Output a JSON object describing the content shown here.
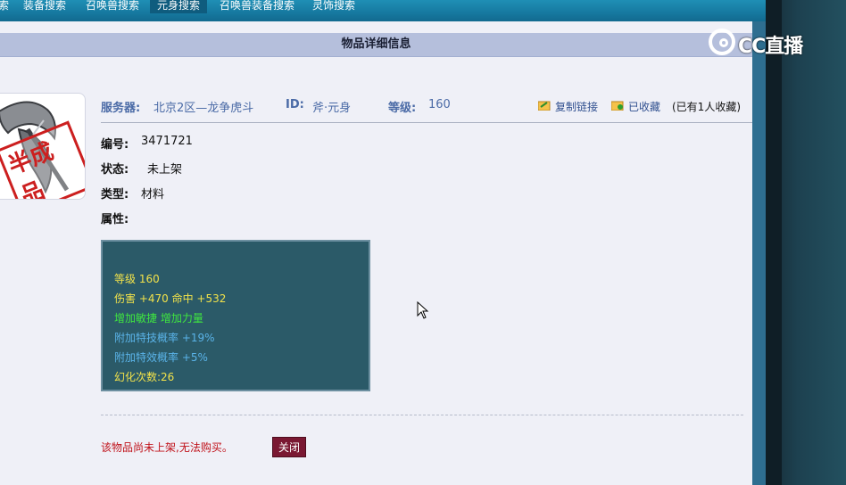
{
  "nav": {
    "tabs": [
      {
        "label": "索"
      },
      {
        "label": "装备搜索"
      },
      {
        "label": "召唤兽搜索"
      },
      {
        "label": "元身搜索",
        "active": true
      },
      {
        "label": "召唤兽装备搜索"
      },
      {
        "label": "灵饰搜索"
      }
    ]
  },
  "watermark": {
    "text": "CC直播"
  },
  "panel": {
    "title": "物品详细信息"
  },
  "item_image": {
    "stamp_text": "半成品"
  },
  "info": {
    "server_label": "服务器:",
    "server_value": "北京2区—龙争虎斗",
    "id_label": "ID:",
    "id_value": "斧·元身",
    "level_label": "等级:",
    "level_value": "160",
    "copy_link": "复制链接",
    "favorited": "已收藏",
    "favorite_count": "(已有1人收藏)"
  },
  "fields": {
    "number_label": "编号:",
    "number_value": "3471721",
    "status_label": "状态:",
    "status_value": "未上架",
    "type_label": "类型:",
    "type_value": "材料",
    "attr_label": "属性:"
  },
  "attributes": [
    {
      "text": "等级 160",
      "color": "#f2e24a"
    },
    {
      "text": "伤害 +470 命中 +532",
      "color": "#f2e24a"
    },
    {
      "text": "增加敏捷 增加力量",
      "color": "#3fe63f"
    },
    {
      "text": "附加特技概率 +19%",
      "color": "#5ab3e8"
    },
    {
      "text": "附加特效概率 +5%",
      "color": "#5ab3e8"
    },
    {
      "text": "幻化次数:26",
      "color": "#f2e24a"
    }
  ],
  "bottom": {
    "notice": "该物品尚未上架,无法购买。",
    "close_label": "关闭"
  },
  "colors": {
    "nav_bg": "#1679a0",
    "header_bg": "#b5bfdc",
    "attr_box_bg": "#2b5a68",
    "notice": "#c0121a",
    "close_btn": "#7a1832"
  }
}
